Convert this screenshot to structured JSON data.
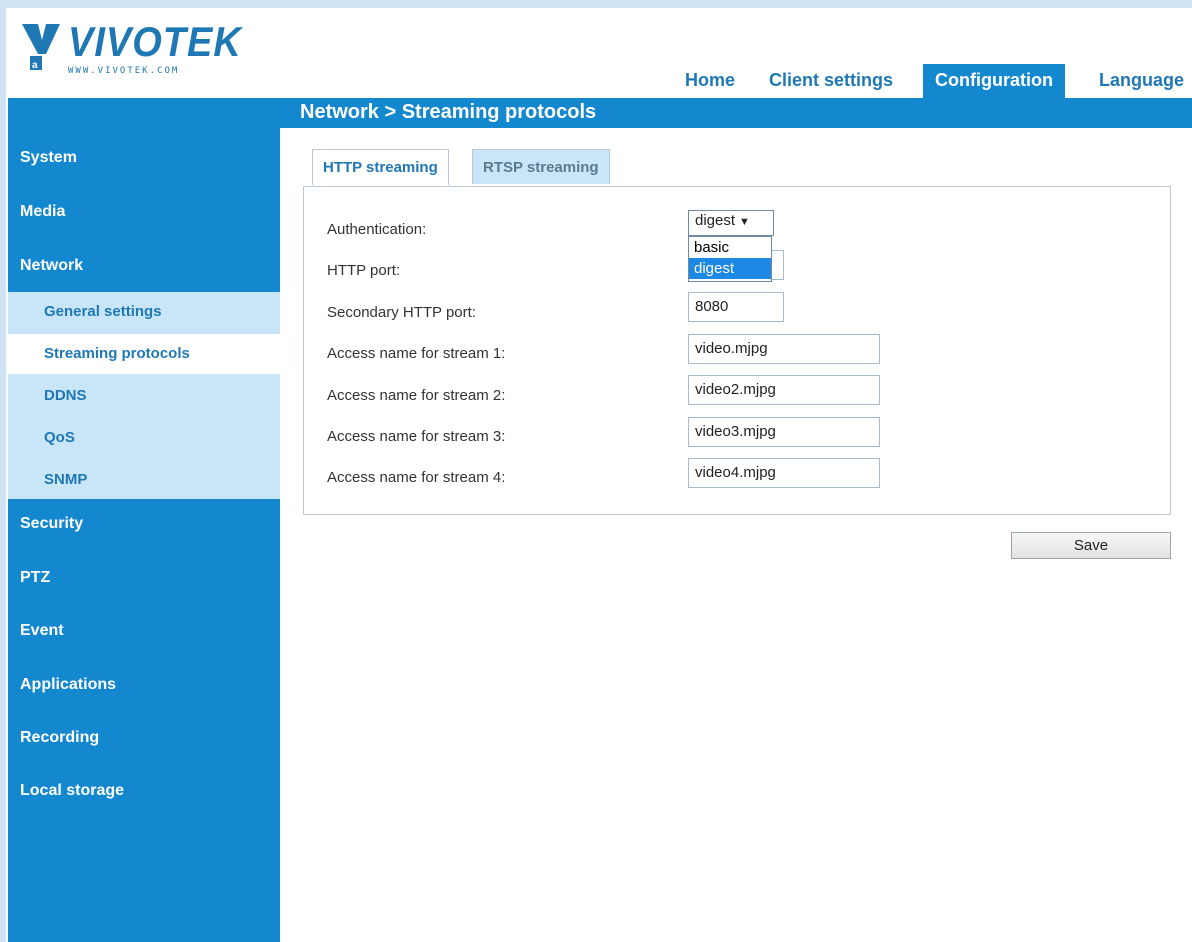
{
  "brand": {
    "name": "VIVOTEK",
    "url": "WWW.VIVOTEK.COM"
  },
  "top_nav": [
    {
      "label": "Home"
    },
    {
      "label": "Client settings"
    },
    {
      "label": "Configuration",
      "active": true
    },
    {
      "label": "Language"
    }
  ],
  "page_title": "Network  > Streaming protocols",
  "sidebar": {
    "items": [
      {
        "label": "System"
      },
      {
        "label": "Media"
      },
      {
        "label": "Network"
      },
      {
        "label": "Security"
      },
      {
        "label": "PTZ"
      },
      {
        "label": "Event"
      },
      {
        "label": "Applications"
      },
      {
        "label": "Recording"
      },
      {
        "label": "Local storage"
      }
    ],
    "network_subitems": [
      {
        "label": "General settings"
      },
      {
        "label": "Streaming protocols",
        "selected": true
      },
      {
        "label": "DDNS"
      },
      {
        "label": "QoS"
      },
      {
        "label": "SNMP"
      }
    ]
  },
  "tabs": [
    {
      "label": "HTTP streaming",
      "active": true
    },
    {
      "label": "RTSP streaming"
    }
  ],
  "form": {
    "authentication": {
      "label": "Authentication:",
      "value": "digest",
      "options": [
        "basic",
        "digest"
      ]
    },
    "http_port": {
      "label": "HTTP port:",
      "value": ""
    },
    "secondary_http_port": {
      "label": "Secondary HTTP port:",
      "value": "8080"
    },
    "streams": [
      {
        "label": "Access name for stream 1:",
        "value": "video.mjpg"
      },
      {
        "label": "Access name for stream 2:",
        "value": "video2.mjpg"
      },
      {
        "label": "Access name for stream 3:",
        "value": "video3.mjpg"
      },
      {
        "label": "Access name for stream 4:",
        "value": "video4.mjpg"
      }
    ]
  },
  "buttons": {
    "save": "Save"
  },
  "colors": {
    "primary_blue": "#1488cf",
    "light_blue": "#c8e6f8",
    "link_blue": "#1f78b4",
    "option_selected": "#1e88e5"
  }
}
